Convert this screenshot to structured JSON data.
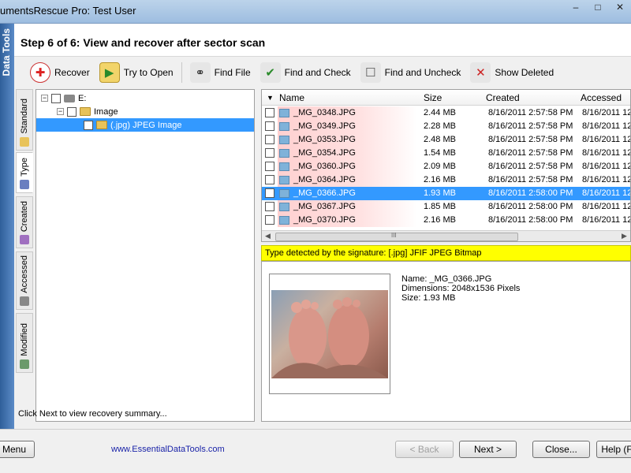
{
  "window": {
    "title": "umentsRescue Pro: Test User",
    "controls": [
      "–",
      "□",
      "✕"
    ]
  },
  "brand_strip": "Data Tools",
  "header": {
    "step": "Step 6 of 6: View and recover after sector scan"
  },
  "toolbar": {
    "recover": "Recover",
    "try_open": "Try to Open",
    "find_file": "Find File",
    "find_check": "Find and Check",
    "find_uncheck": "Find and Uncheck",
    "show_deleted": "Show Deleted"
  },
  "side_tabs": [
    "Standard",
    "Type",
    "Created",
    "Accessed",
    "Modified"
  ],
  "active_side_tab": "Type",
  "tree": {
    "drive": "E:",
    "folder": "Image",
    "leaf": "(.jpg) JPEG Image"
  },
  "list": {
    "columns": {
      "name": "Name",
      "size": "Size",
      "created": "Created",
      "accessed": "Accessed"
    },
    "rows": [
      {
        "name": "_MG_0348.JPG",
        "size": "2.44 MB",
        "created": "8/16/2011 2:57:58 PM",
        "accessed": "8/16/2011 12"
      },
      {
        "name": "_MG_0349.JPG",
        "size": "2.28 MB",
        "created": "8/16/2011 2:57:58 PM",
        "accessed": "8/16/2011 12"
      },
      {
        "name": "_MG_0353.JPG",
        "size": "2.48 MB",
        "created": "8/16/2011 2:57:58 PM",
        "accessed": "8/16/2011 12"
      },
      {
        "name": "_MG_0354.JPG",
        "size": "1.54 MB",
        "created": "8/16/2011 2:57:58 PM",
        "accessed": "8/16/2011 12"
      },
      {
        "name": "_MG_0360.JPG",
        "size": "2.09 MB",
        "created": "8/16/2011 2:57:58 PM",
        "accessed": "8/16/2011 12"
      },
      {
        "name": "_MG_0364.JPG",
        "size": "2.16 MB",
        "created": "8/16/2011 2:57:58 PM",
        "accessed": "8/16/2011 12"
      },
      {
        "name": "_MG_0366.JPG",
        "size": "1.93 MB",
        "created": "8/16/2011 2:58:00 PM",
        "accessed": "8/16/2011 12"
      },
      {
        "name": "_MG_0367.JPG",
        "size": "1.85 MB",
        "created": "8/16/2011 2:58:00 PM",
        "accessed": "8/16/2011 12"
      },
      {
        "name": "_MG_0370.JPG",
        "size": "2.16 MB",
        "created": "8/16/2011 2:58:00 PM",
        "accessed": "8/16/2011 12"
      }
    ],
    "selected_index": 6,
    "scroll_mark": "III"
  },
  "signature": "Type detected by the signature: [.jpg] JFIF JPEG Bitmap",
  "preview": {
    "name": "Name: _MG_0366.JPG",
    "dimensions": "Dimensions: 2048x1536 Pixels",
    "size": "Size: 1.93 MB"
  },
  "status": "Click Next to view recovery summary...",
  "footer": {
    "menu": "Menu",
    "link": "www.EssentialDataTools.com",
    "back": "< Back",
    "next": "Next >",
    "close": "Close...",
    "help": "Help (F"
  }
}
